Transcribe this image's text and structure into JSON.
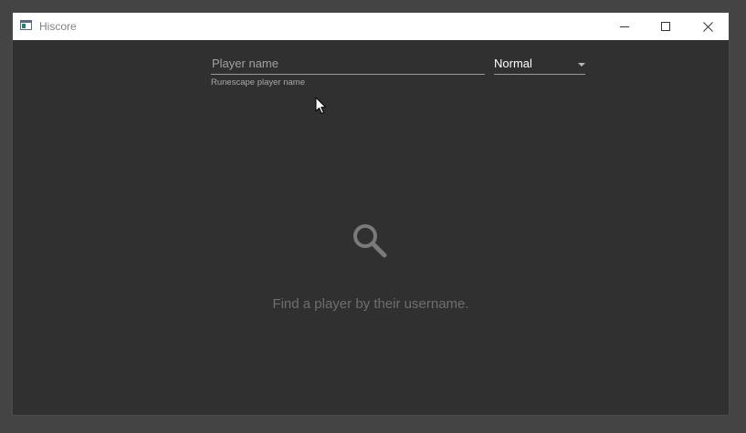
{
  "window": {
    "title": "Hiscore"
  },
  "search": {
    "placeholder": "Player name",
    "value": "",
    "helper": "Runescape player name"
  },
  "mode": {
    "selected": "Normal"
  },
  "empty_state": {
    "message": "Find a player by their username.",
    "icon": "search-icon"
  },
  "icons": {
    "app": "app-window-icon",
    "minimize": "minimize-icon",
    "maximize": "maximize-icon",
    "close": "close-icon",
    "cursor": "mouse-pointer-icon"
  },
  "colors": {
    "window_background": "#303030",
    "titlebar_background": "#ffffff",
    "muted_text": "#6e6e6e"
  }
}
